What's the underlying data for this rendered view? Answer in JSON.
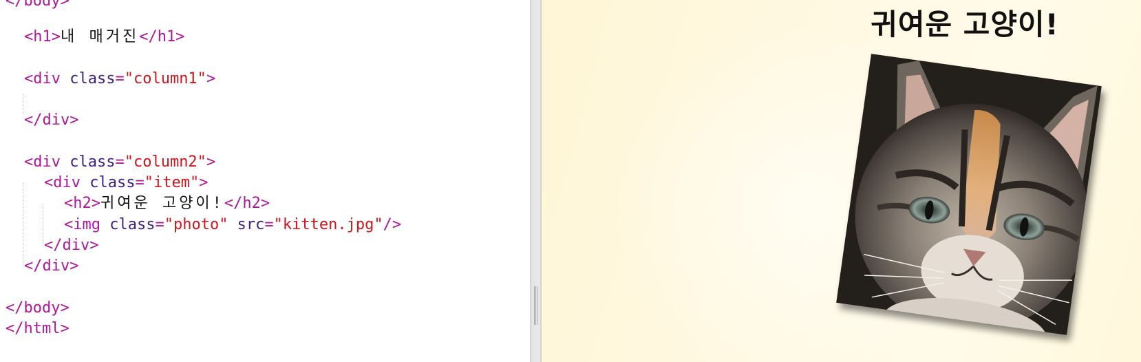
{
  "editor": {
    "lines": [
      {
        "tokens": [
          {
            "t": "</body>",
            "c": "tk-tag"
          }
        ]
      },
      {
        "tokens": [
          {
            "t": "<h1>",
            "c": "tk-tag"
          },
          {
            "t": "내 매거진",
            "c": "tk-text"
          },
          {
            "t": "</h1>",
            "c": "tk-tag"
          }
        ]
      },
      {
        "tokens": [
          {
            "t": "<div ",
            "c": "tk-tag"
          },
          {
            "t": "class",
            "c": "tk-attr"
          },
          {
            "t": "=",
            "c": "tk-punct"
          },
          {
            "t": "\"column1\"",
            "c": "tk-str"
          },
          {
            "t": ">",
            "c": "tk-tag"
          }
        ]
      },
      {
        "tokens": [
          {
            "t": "</div>",
            "c": "tk-tag"
          }
        ]
      },
      {
        "tokens": [
          {
            "t": "<div ",
            "c": "tk-tag"
          },
          {
            "t": "class",
            "c": "tk-attr"
          },
          {
            "t": "=",
            "c": "tk-punct"
          },
          {
            "t": "\"column2\"",
            "c": "tk-str"
          },
          {
            "t": ">",
            "c": "tk-tag"
          }
        ]
      },
      {
        "tokens": [
          {
            "t": "<div ",
            "c": "tk-tag"
          },
          {
            "t": "class",
            "c": "tk-attr"
          },
          {
            "t": "=",
            "c": "tk-punct"
          },
          {
            "t": "\"item\"",
            "c": "tk-str"
          },
          {
            "t": ">",
            "c": "tk-tag"
          }
        ]
      },
      {
        "tokens": [
          {
            "t": "<h2>",
            "c": "tk-tag"
          },
          {
            "t": "귀여운 고양이!",
            "c": "tk-text"
          },
          {
            "t": "</h2>",
            "c": "tk-tag"
          }
        ]
      },
      {
        "tokens": [
          {
            "t": "<img ",
            "c": "tk-tag"
          },
          {
            "t": "class",
            "c": "tk-attr"
          },
          {
            "t": "=",
            "c": "tk-punct"
          },
          {
            "t": "\"photo\"",
            "c": "tk-str"
          },
          {
            "t": " src",
            "c": "tk-attr"
          },
          {
            "t": "=",
            "c": "tk-punct"
          },
          {
            "t": "\"kitten.jpg\"",
            "c": "tk-str"
          },
          {
            "t": "/>",
            "c": "tk-tag"
          }
        ]
      },
      {
        "tokens": [
          {
            "t": "</div>",
            "c": "tk-tag"
          }
        ]
      },
      {
        "tokens": [
          {
            "t": "</div>",
            "c": "tk-tag"
          }
        ]
      },
      {
        "tokens": [
          {
            "t": "</body>",
            "c": "tk-tag"
          }
        ]
      },
      {
        "tokens": [
          {
            "t": "</html>",
            "c": "tk-tag"
          }
        ]
      }
    ]
  },
  "preview": {
    "heading": "귀여운 고양이!",
    "image": "kitten-photo"
  },
  "colors": {
    "tag": "#b0169a",
    "attribute": "#3d1e86",
    "string": "#d2141c",
    "preview_background": "#fff8dc"
  }
}
